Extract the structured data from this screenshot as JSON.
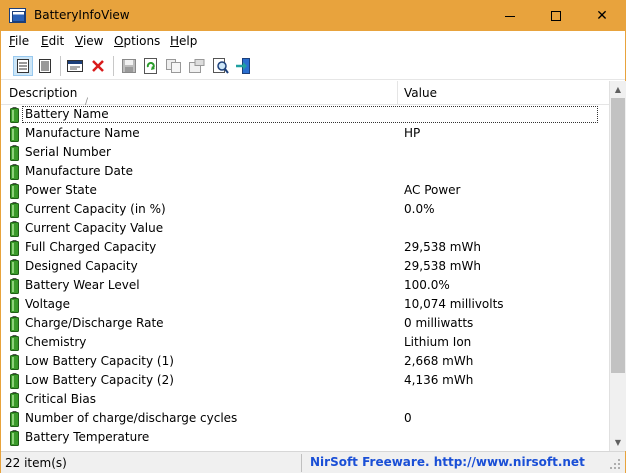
{
  "window": {
    "title": "BatteryInfoView",
    "minimize_icon": "minimize-icon",
    "maximize_icon": "maximize-icon",
    "close_glyph": "✕"
  },
  "menu": [
    {
      "label": "File",
      "accel": "F",
      "rest": "ile"
    },
    {
      "label": "Edit",
      "accel": "E",
      "rest": "dit"
    },
    {
      "label": "View",
      "accel": "V",
      "rest": "iew"
    },
    {
      "label": "Options",
      "accel": "O",
      "rest": "ptions"
    },
    {
      "label": "Help",
      "accel": "H",
      "rest": "elp"
    }
  ],
  "toolbar": {
    "icons": [
      "battery-info-mode-icon",
      "battery-log-mode-icon",
      "properties-window-icon",
      "delete-icon",
      "save-icon",
      "refresh-icon",
      "copy-icon",
      "properties-icon",
      "find-icon",
      "exit-icon"
    ]
  },
  "columns": {
    "description": "Description",
    "value": "Value"
  },
  "rows": [
    {
      "description": "Battery Name",
      "value": ""
    },
    {
      "description": "Manufacture Name",
      "value": "HP"
    },
    {
      "description": "Serial Number",
      "value": ""
    },
    {
      "description": "Manufacture Date",
      "value": ""
    },
    {
      "description": "Power State",
      "value": "AC Power"
    },
    {
      "description": "Current Capacity (in %)",
      "value": "0.0%"
    },
    {
      "description": "Current Capacity Value",
      "value": ""
    },
    {
      "description": "Full Charged Capacity",
      "value": "29,538 mWh"
    },
    {
      "description": "Designed Capacity",
      "value": "29,538 mWh"
    },
    {
      "description": "Battery Wear Level",
      "value": "100.0%"
    },
    {
      "description": "Voltage",
      "value": "10,074 millivolts"
    },
    {
      "description": "Charge/Discharge Rate",
      "value": "0 milliwatts"
    },
    {
      "description": "Chemistry",
      "value": "Lithium Ion"
    },
    {
      "description": "Low Battery Capacity (1)",
      "value": "2,668 mWh"
    },
    {
      "description": "Low Battery Capacity (2)",
      "value": "4,136 mWh"
    },
    {
      "description": "Critical Bias",
      "value": ""
    },
    {
      "description": "Number of charge/discharge cycles",
      "value": "0"
    },
    {
      "description": "Battery Temperature",
      "value": ""
    }
  ],
  "status": {
    "count": "22 item(s)",
    "link": "NirSoft Freeware.  http://www.nirsoft.net"
  },
  "colors": {
    "title_bar": "#e8a33d",
    "battery_green": "#3a9a2a",
    "link_blue": "#1a4fd6"
  }
}
